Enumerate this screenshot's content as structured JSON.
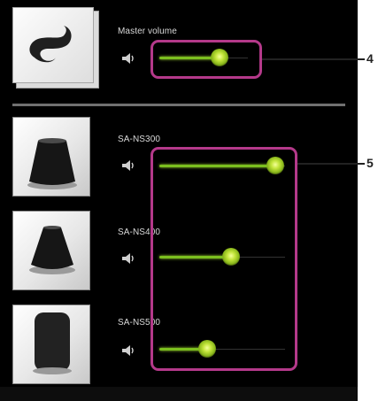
{
  "master": {
    "label": "Master volume",
    "volume": 0.68,
    "icon": "music-note-icon"
  },
  "speakers": [
    {
      "label": "SA-NS300",
      "volume": 0.92,
      "icon": "speaker-cone-icon"
    },
    {
      "label": "SA-NS400",
      "volume": 0.57,
      "icon": "speaker-cone-icon"
    },
    {
      "label": "SA-NS500",
      "volume": 0.38,
      "icon": "speaker-cylinder-icon"
    }
  ],
  "callouts": [
    {
      "number": "4"
    },
    {
      "number": "5"
    }
  ],
  "colors": {
    "accent": "#8cc63f",
    "callout": "#b4398a",
    "background": "#000000"
  }
}
